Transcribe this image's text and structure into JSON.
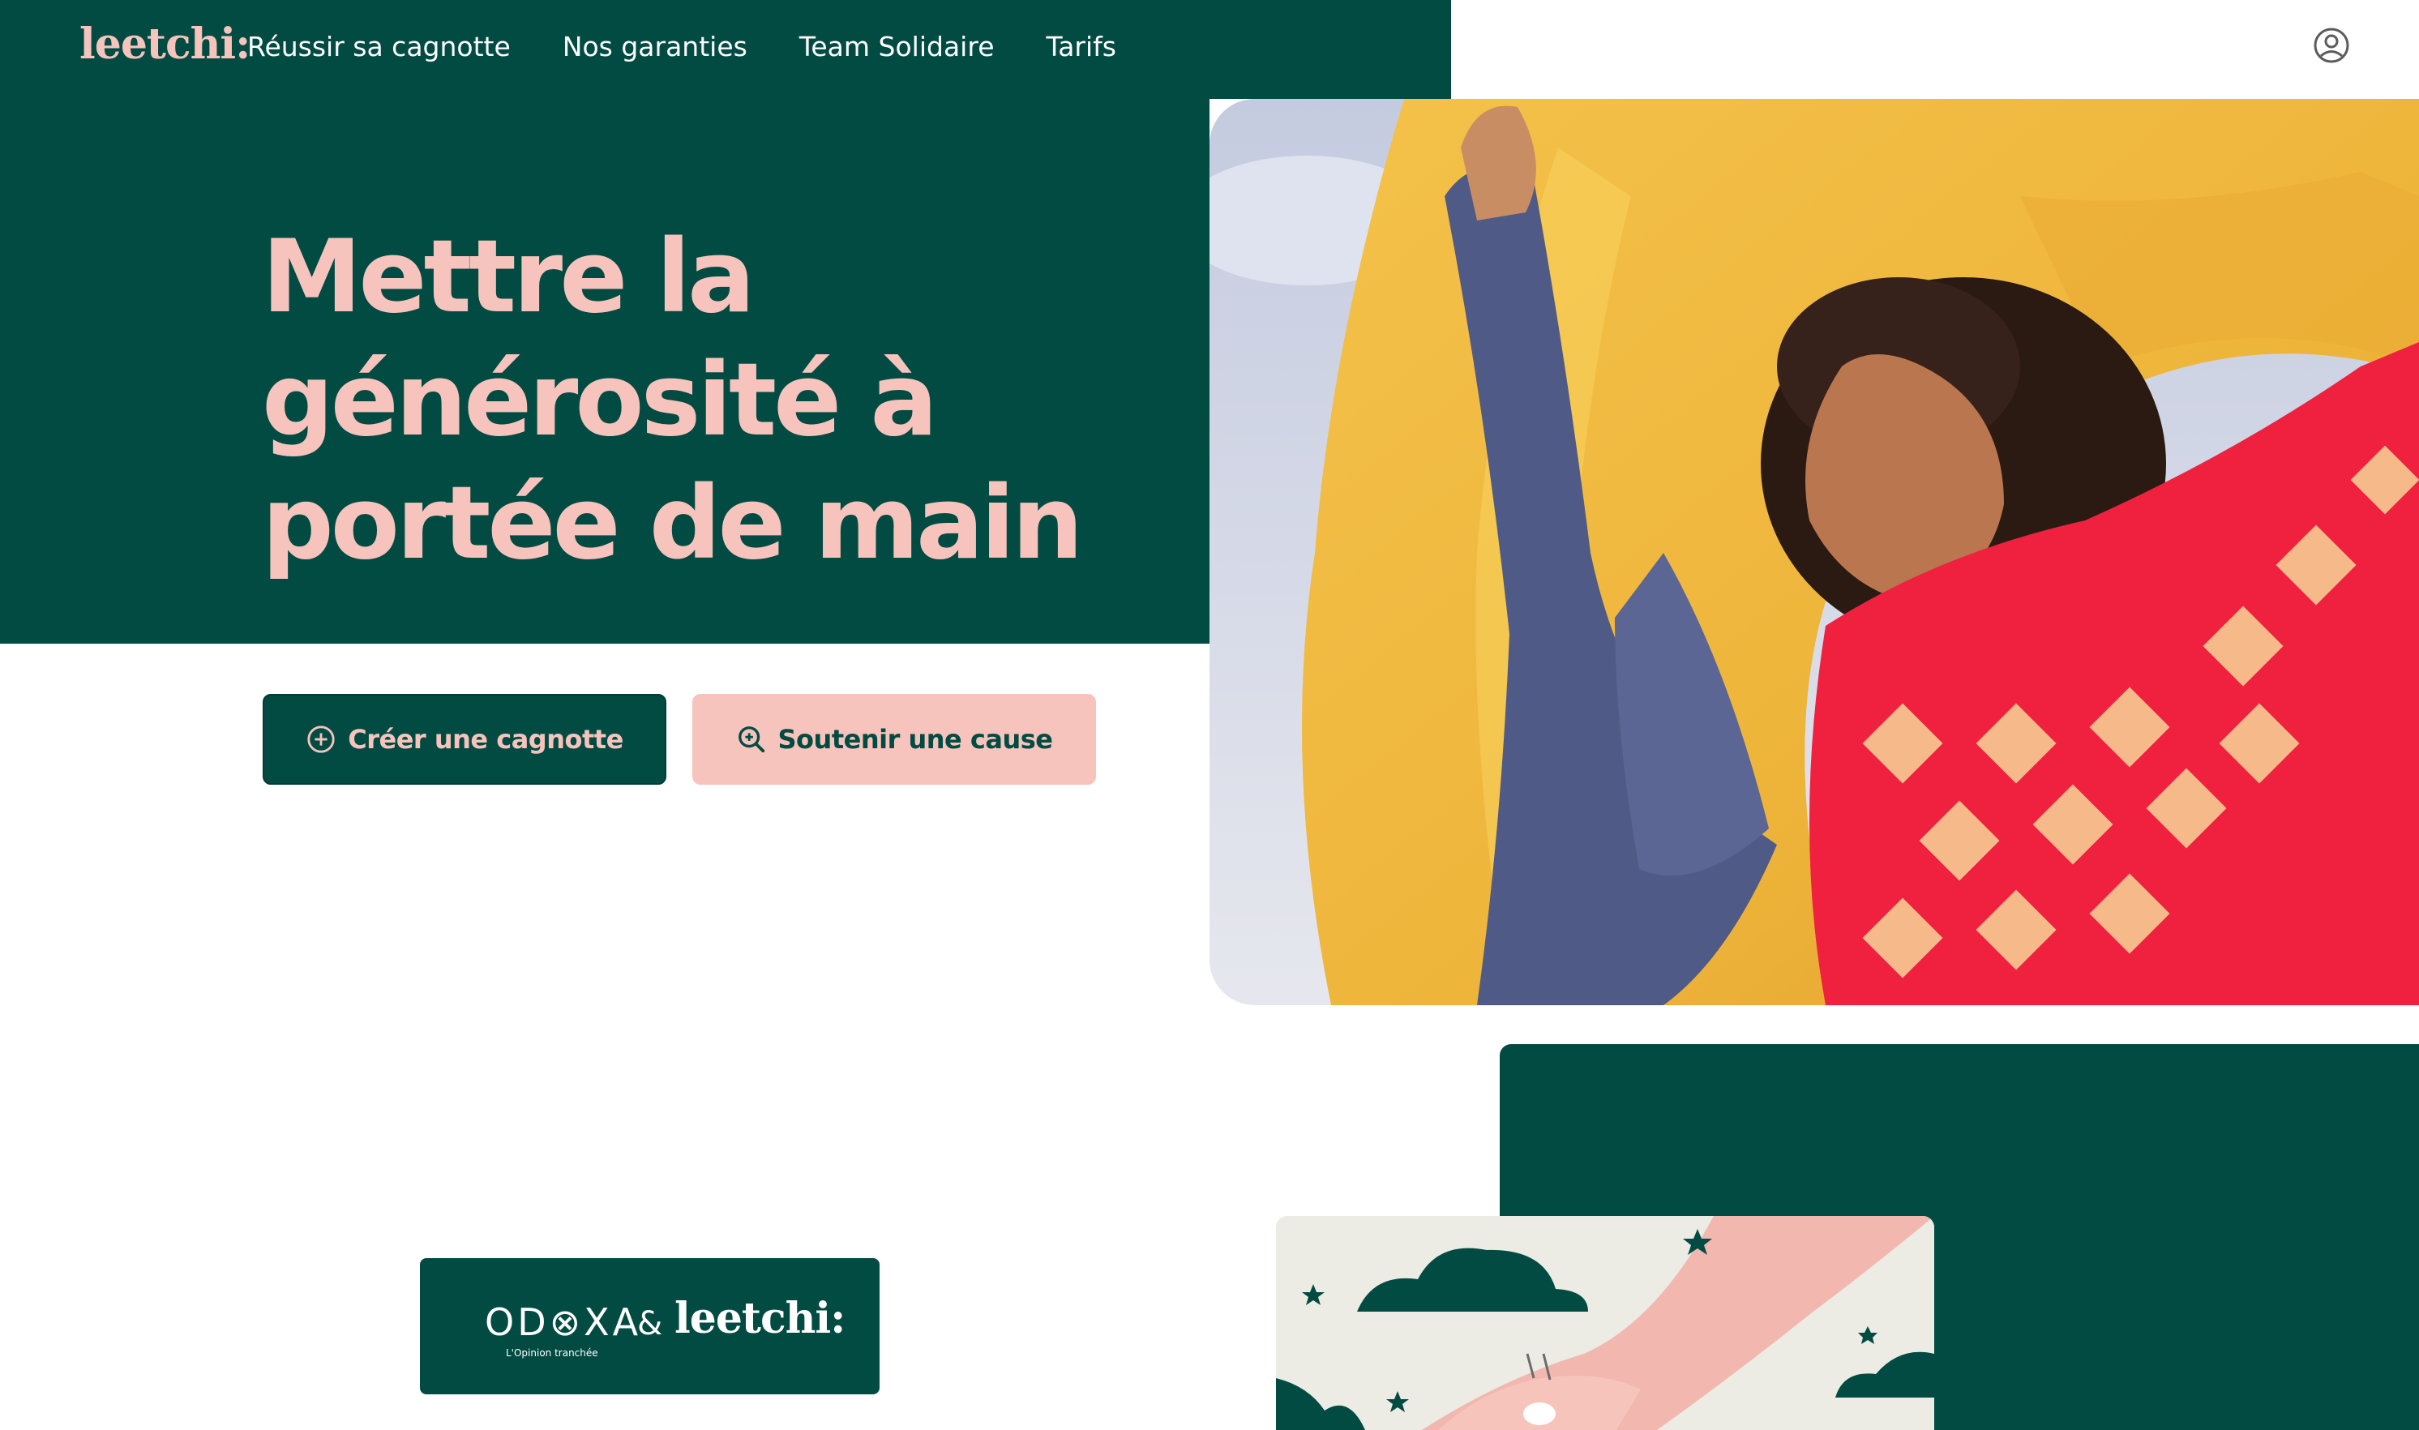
{
  "brand": {
    "logo_text": "leetchi:"
  },
  "nav": {
    "items": [
      {
        "label": "Réussir sa cagnotte"
      },
      {
        "label": "Nos garanties"
      },
      {
        "label": "Team Solidaire"
      },
      {
        "label": "Tarifs"
      }
    ],
    "user_icon": "user-circle-icon"
  },
  "hero": {
    "headline": "Mettre la générosité à portée de main",
    "buttons": {
      "create": {
        "label": "Créer une cagnotte",
        "icon": "plus-circle-icon"
      },
      "support": {
        "label": "Soutenir une cause",
        "icon": "search-zoom-icon"
      }
    }
  },
  "partner": {
    "odoxa": "OD⊗XA",
    "amp": "&",
    "leetchi": "leetchi:",
    "tagline": "L'Opinion tranchée"
  },
  "colors": {
    "green": "#024b43",
    "pink": "#f6c4bc",
    "white": "#ffffff"
  }
}
